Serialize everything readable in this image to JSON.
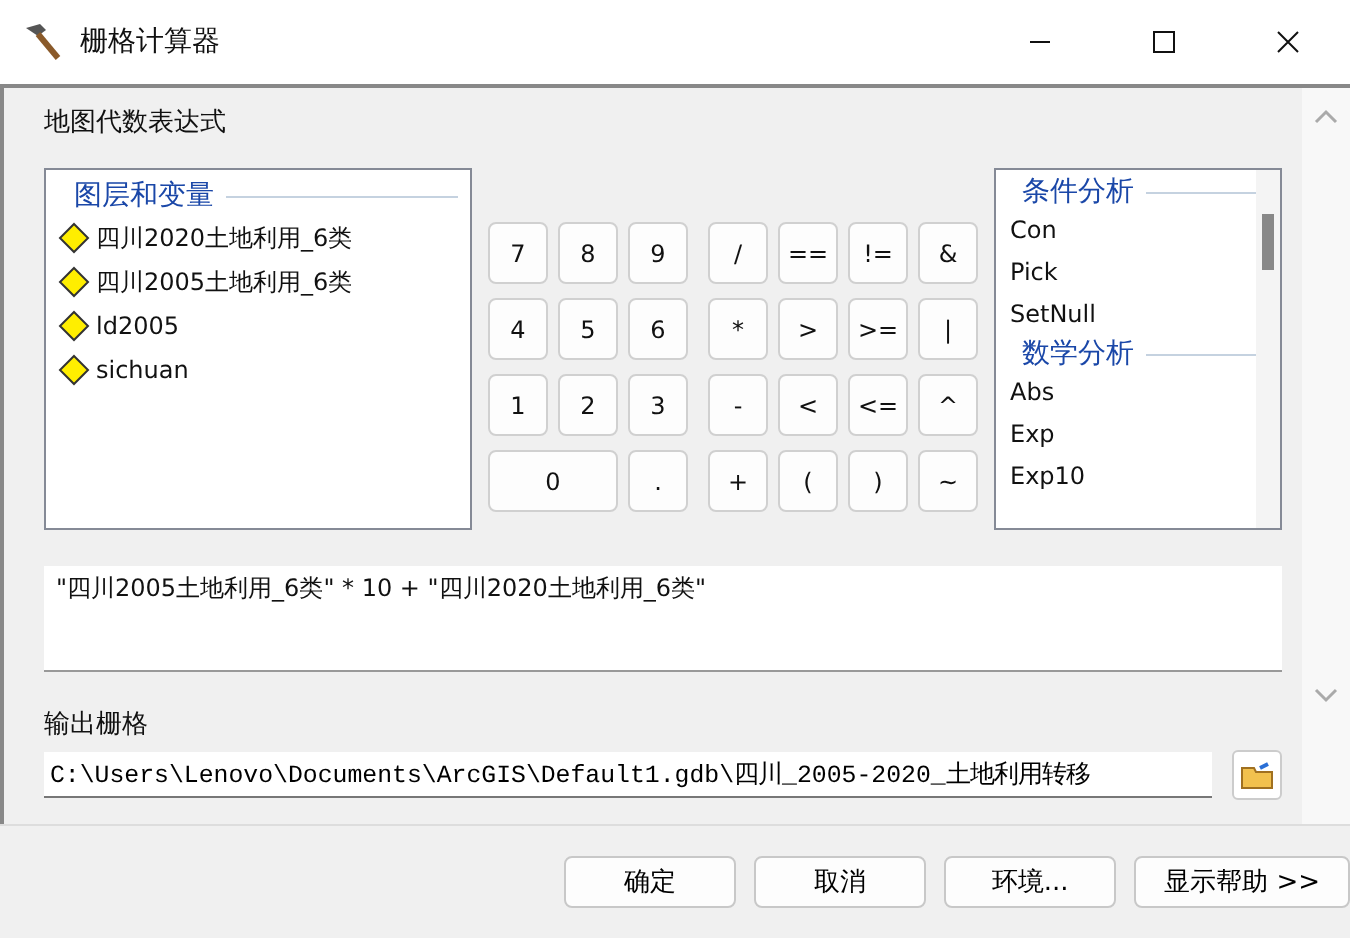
{
  "window": {
    "title": "栅格计算器"
  },
  "expression_label": "地图代数表达式",
  "layers": {
    "heading": "图层和变量",
    "items": [
      {
        "label": "四川2020土地利用_6类"
      },
      {
        "label": "四川2005土地利用_6类"
      },
      {
        "label": "ld2005"
      },
      {
        "label": "sichuan"
      }
    ]
  },
  "digit_keys": [
    {
      "label": "7",
      "kind": "normal"
    },
    {
      "label": "8",
      "kind": "normal"
    },
    {
      "label": "9",
      "kind": "normal"
    },
    {
      "label": "4",
      "kind": "normal"
    },
    {
      "label": "5",
      "kind": "normal"
    },
    {
      "label": "6",
      "kind": "normal"
    },
    {
      "label": "1",
      "kind": "normal"
    },
    {
      "label": "2",
      "kind": "normal"
    },
    {
      "label": "3",
      "kind": "normal"
    },
    {
      "label": "0",
      "kind": "wide"
    },
    {
      "label": ".",
      "kind": "normal"
    }
  ],
  "operator_keys": [
    "/",
    "==",
    "!=",
    "&",
    "*",
    ">",
    ">=",
    "|",
    "-",
    "<",
    "<=",
    "^",
    "+",
    "(",
    ")",
    "~"
  ],
  "functions": [
    {
      "heading": "条件分析",
      "items": [
        "Con",
        "Pick",
        "SetNull"
      ]
    },
    {
      "heading": "数学分析",
      "items": [
        "Abs",
        "Exp",
        "Exp10"
      ]
    }
  ],
  "expression": "\"四川2005土地利用_6类\" * 10 + \"四川2020土地利用_6类\"",
  "output_label": "输出栅格",
  "output_path": "C:\\Users\\Lenovo\\Documents\\ArcGIS\\Default1.gdb\\四川_2005-2020_土地利用转移",
  "buttons": [
    "确定",
    "取消",
    "环境...",
    "显示帮助 >>"
  ]
}
